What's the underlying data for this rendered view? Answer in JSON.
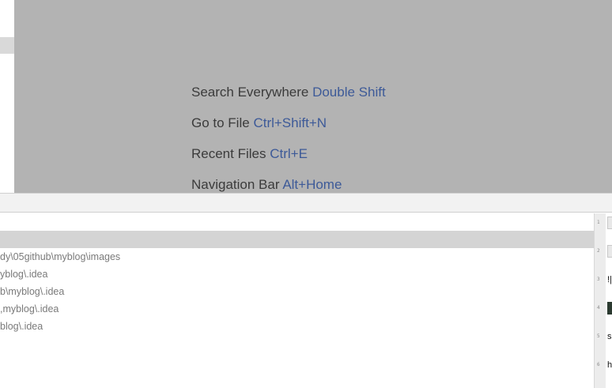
{
  "editor_hints": [
    {
      "label": "Search Everywhere",
      "shortcut": "Double Shift"
    },
    {
      "label": "Go to File",
      "shortcut": "Ctrl+Shift+N"
    },
    {
      "label": "Recent Files",
      "shortcut": "Ctrl+E"
    },
    {
      "label": "Navigation Bar",
      "shortcut": "Alt+Home"
    }
  ],
  "path_list": [
    {
      "text": ""
    },
    {
      "text": "dy\\05github\\myblog\\images"
    },
    {
      "text": "yblog\\.idea"
    },
    {
      "text": "b\\myblog\\.idea"
    },
    {
      "text": ",myblog\\.idea"
    },
    {
      "text": "blog\\.idea"
    }
  ],
  "right_preview": {
    "line_numbers": [
      "1",
      "2",
      "3",
      "4",
      "5",
      "6"
    ],
    "cells": [
      "",
      "",
      "!|",
      "",
      "s",
      "h"
    ]
  },
  "colors": {
    "editor_background": "#b3b3b3",
    "shortcut_text": "#3d5a98",
    "selected_row": "#d4d4d4"
  }
}
